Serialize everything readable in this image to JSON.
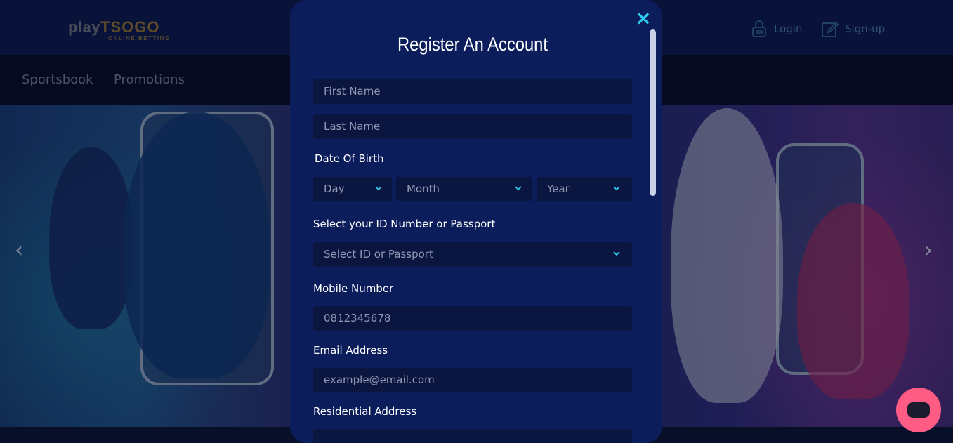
{
  "header": {
    "logo_play": "play",
    "logo_brand": "TSOGO",
    "logo_tagline": "ONLINE BETTING",
    "login_label": "Login",
    "signup_label": "Sign-up"
  },
  "nav": {
    "items": [
      {
        "label": "Sportsbook"
      },
      {
        "label": "Promotions"
      }
    ]
  },
  "hero": {
    "prev_arrow": "‹",
    "next_arrow": "›"
  },
  "modal": {
    "title": "Register An Account",
    "close_icon": "×",
    "first_name_placeholder": "First Name",
    "last_name_placeholder": "Last Name",
    "dob_label": "Date Of Birth",
    "day_value": "Day",
    "month_value": "Month",
    "year_value": "Year",
    "id_label": "Select your ID Number or Passport",
    "id_select_value": "Select ID or Passport",
    "mobile_label": "Mobile Number",
    "mobile_placeholder": "0812345678",
    "email_label": "Email Address",
    "email_placeholder": "example@email.com",
    "address_label": "Residential Address"
  },
  "colors": {
    "accent_close": "#2ec9ec",
    "modal_bg": "#0c1d5c",
    "field_bg": "#0a1540",
    "chat_bubble": "#ff5c85"
  }
}
